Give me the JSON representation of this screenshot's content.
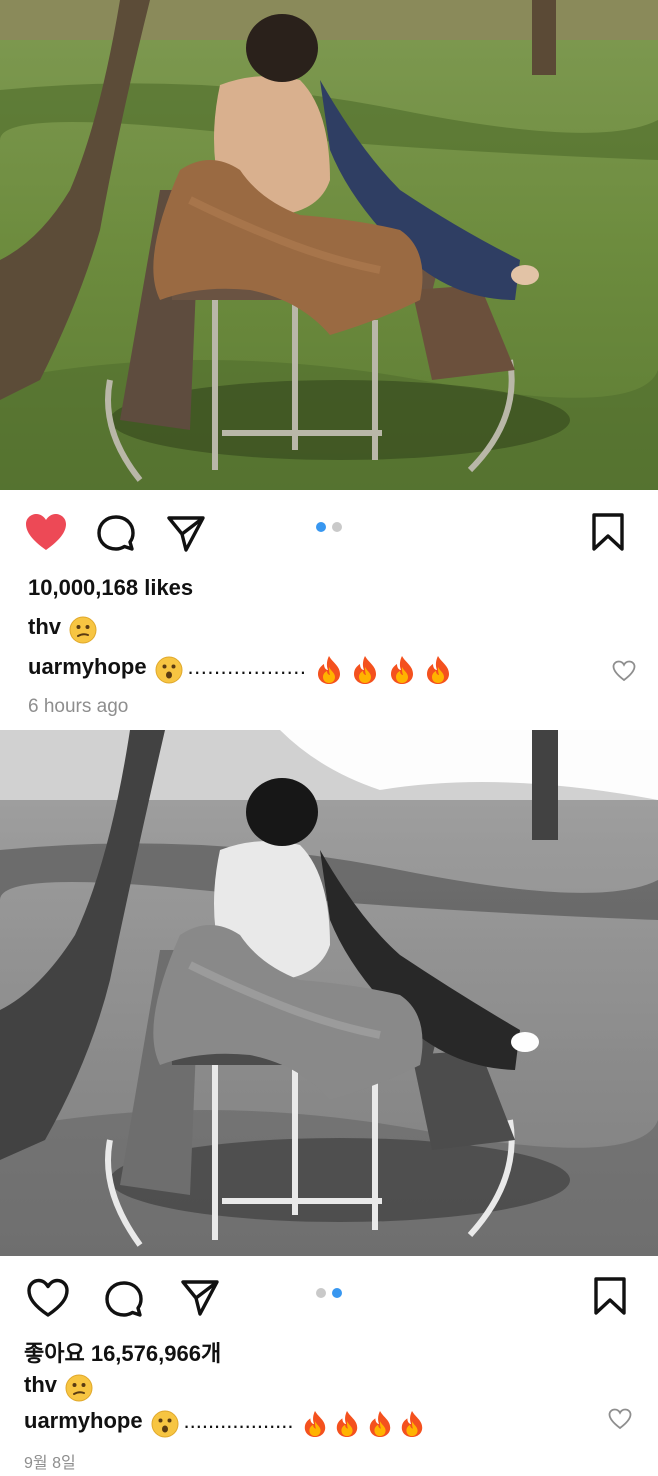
{
  "post1": {
    "likes_text": "10,000,168 likes",
    "caption_user": "thv",
    "comment_user": "uarmyhope",
    "comment_dots": "..................",
    "timestamp": "6 hours ago",
    "liked": true,
    "carousel_active_index": 0,
    "carousel_count": 2
  },
  "post2": {
    "likes_text": "좋아요 16,576,966개",
    "caption_user": "thv",
    "comment_user": "uarmyhope",
    "comment_dots": "..................",
    "timestamp": "9월 8일",
    "liked": false,
    "carousel_active_index": 1,
    "carousel_count": 2
  },
  "colors": {
    "liked_heart": "#ed4956",
    "carousel_active": "#3897f0",
    "carousel_inactive": "#c9c9c9",
    "timestamp_gray": "#8e8e8e"
  },
  "icons": {
    "like": "heart-icon",
    "comment": "comment-bubble-icon",
    "share": "paper-plane-icon",
    "save": "bookmark-icon",
    "comment_like": "small-heart-icon"
  }
}
